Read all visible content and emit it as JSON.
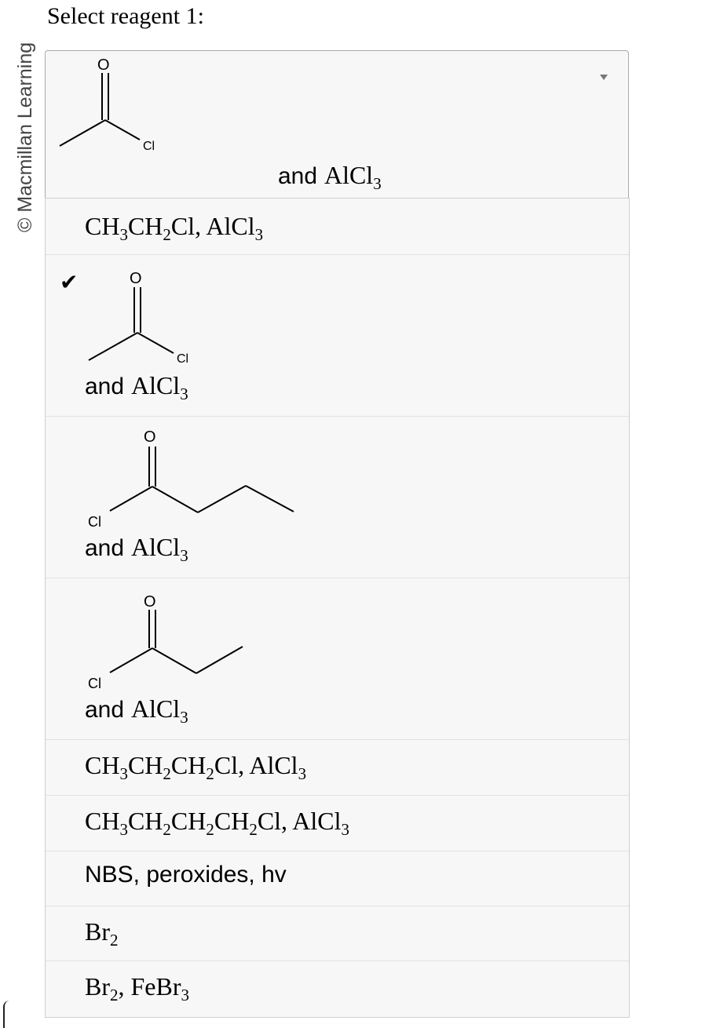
{
  "copyright": "© Macmillan Learning",
  "prompt": "Select reagent 1:",
  "dropdown": {
    "selected": {
      "atoms": {
        "O": "O",
        "Cl": "Cl"
      },
      "and_word": "and",
      "reagent": "AlCl",
      "reagent_sub": "3"
    },
    "icons": {
      "arrow": "chevron-down-icon",
      "check": "checkmark-icon"
    },
    "options": [
      {
        "parts": [
          "CH",
          "3",
          "CH",
          "2",
          "Cl, AlCl",
          "3"
        ]
      },
      {
        "selected": true,
        "atoms": {
          "O": "O",
          "Cl": "Cl"
        },
        "and_word": "and",
        "reagent": "AlCl",
        "reagent_sub": "3"
      },
      {
        "atoms": {
          "O": "O",
          "Cl": "Cl"
        },
        "and_word": "and",
        "reagent": "AlCl",
        "reagent_sub": "3"
      },
      {
        "atoms": {
          "O": "O",
          "Cl": "Cl"
        },
        "and_word": "and",
        "reagent": "AlCl",
        "reagent_sub": "3"
      },
      {
        "parts": [
          "CH",
          "3",
          "CH",
          "2",
          "CH",
          "2",
          "Cl, AlCl",
          "3"
        ]
      },
      {
        "parts": [
          "CH",
          "3",
          "CH",
          "2",
          "CH",
          "2",
          "CH",
          "2",
          "Cl, AlCl",
          "3"
        ]
      },
      {
        "text": "NBS, peroxides, hv"
      },
      {
        "parts": [
          "Br",
          "2"
        ]
      },
      {
        "parts": [
          "Br",
          "2",
          ", FeBr",
          "3"
        ]
      }
    ]
  },
  "colors": {
    "menu_bg": "#f7f7f8",
    "border": "#a9a9ad"
  }
}
